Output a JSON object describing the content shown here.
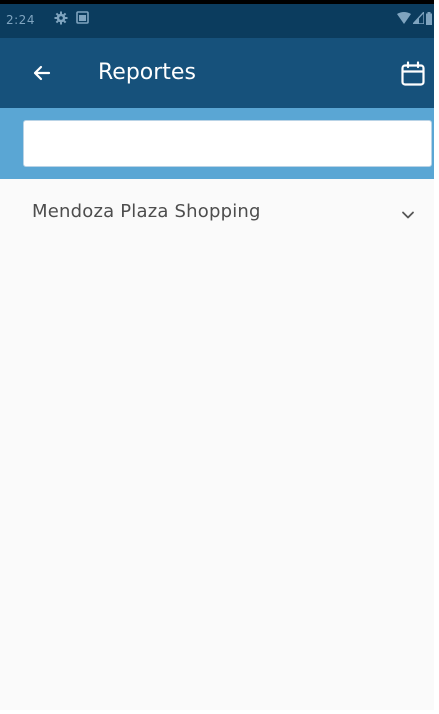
{
  "status_bar": {
    "time": "2:24",
    "icons": [
      "gear-icon",
      "image-icon",
      "wifi-icon",
      "signal-icon",
      "battery-icon"
    ]
  },
  "app_bar": {
    "title": "Reportes",
    "back_icon": "arrow-left-icon",
    "action_icon": "calendar-icon"
  },
  "search": {
    "value": "",
    "placeholder": ""
  },
  "list": {
    "items": [
      {
        "label": "Mendoza Plaza Shopping",
        "icon": "chevron-down-icon"
      }
    ]
  },
  "colors": {
    "status_bar": "#0b3c5e",
    "app_bar": "#16517b",
    "search_band": "#5aa6d4",
    "background": "#fafafa"
  }
}
